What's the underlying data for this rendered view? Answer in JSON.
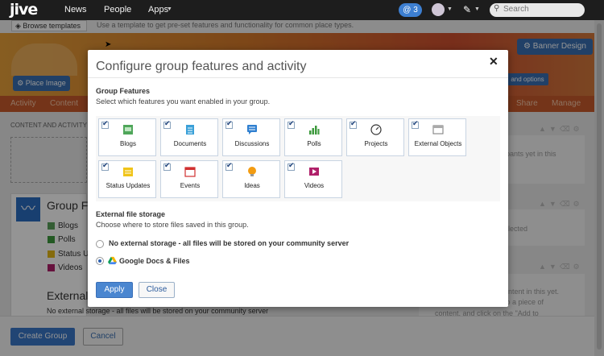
{
  "nav": {
    "logo": "jive",
    "links": [
      "News",
      "People",
      "Apps"
    ],
    "mentions_count": "3",
    "search_placeholder": "Search"
  },
  "background": {
    "template_button": "Browse templates",
    "template_hint": "Use a template to get pre-set features and functionality for common place types.",
    "banner_design": "Banner Design",
    "place_image": "Place Image",
    "banner_options": "and options",
    "tabs": [
      "Activity",
      "Content",
      "Share",
      "Manage"
    ],
    "content_activity": "CONTENT AND ACTIVITY",
    "group_features_title": "Group F",
    "group_features_items": [
      "Blogs",
      "Polls",
      "Status Up",
      "Videos"
    ],
    "external_title": "External",
    "external_value": "No external storage - all files will be stored on your community server",
    "right_texts": [
      "ipants yet in this",
      "elected",
      "ontent in this yet.",
      "to a piece of",
      "content, and click on the \"Add to"
    ],
    "create_group": "Create Group",
    "cancel": "Cancel"
  },
  "modal": {
    "title": "Configure group features and activity",
    "features_heading": "Group Features",
    "features_sub": "Select which features you want enabled in your group.",
    "features": [
      {
        "label": "Blogs",
        "icon": "blog-icon",
        "checked": true
      },
      {
        "label": "Documents",
        "icon": "document-icon",
        "checked": true
      },
      {
        "label": "Discussions",
        "icon": "discussion-icon",
        "checked": true
      },
      {
        "label": "Polls",
        "icon": "poll-icon",
        "checked": true
      },
      {
        "label": "Projects",
        "icon": "project-icon",
        "checked": true
      },
      {
        "label": "External Objects",
        "icon": "external-object-icon",
        "checked": true
      },
      {
        "label": "Status Updates",
        "icon": "status-update-icon",
        "checked": true
      },
      {
        "label": "Events",
        "icon": "calendar-icon",
        "checked": true
      },
      {
        "label": "Ideas",
        "icon": "idea-icon",
        "checked": true
      },
      {
        "label": "Videos",
        "icon": "video-icon",
        "checked": true
      }
    ],
    "storage_heading": "External file storage",
    "storage_sub": "Choose where to store files saved in this group.",
    "storage_options": [
      {
        "label": "No external storage - all files will be stored on your community server",
        "selected": false
      },
      {
        "label": "Google Docs & Files",
        "selected": true
      }
    ],
    "apply": "Apply",
    "close": "Close"
  },
  "colors": {
    "accent": "#3a77c8",
    "nav_bg": "#1d1d1d",
    "banner_orange": "#d77b2a"
  }
}
